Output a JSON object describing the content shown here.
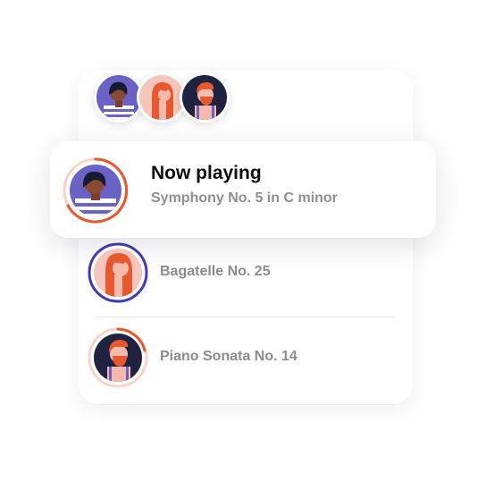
{
  "now_playing": {
    "heading": "Now playing",
    "track": "Symphony No. 5 in C minor"
  },
  "tracks": [
    {
      "title": "Bagatelle No. 25"
    },
    {
      "title": "Piano Sonata No. 14"
    }
  ],
  "colors": {
    "accent": "#e8582f",
    "ring_blue": "#3f3bb2",
    "avatar_purple": "#6a63c5",
    "avatar_pink": "#f6b9ae",
    "avatar_dark": "#1f2340"
  }
}
